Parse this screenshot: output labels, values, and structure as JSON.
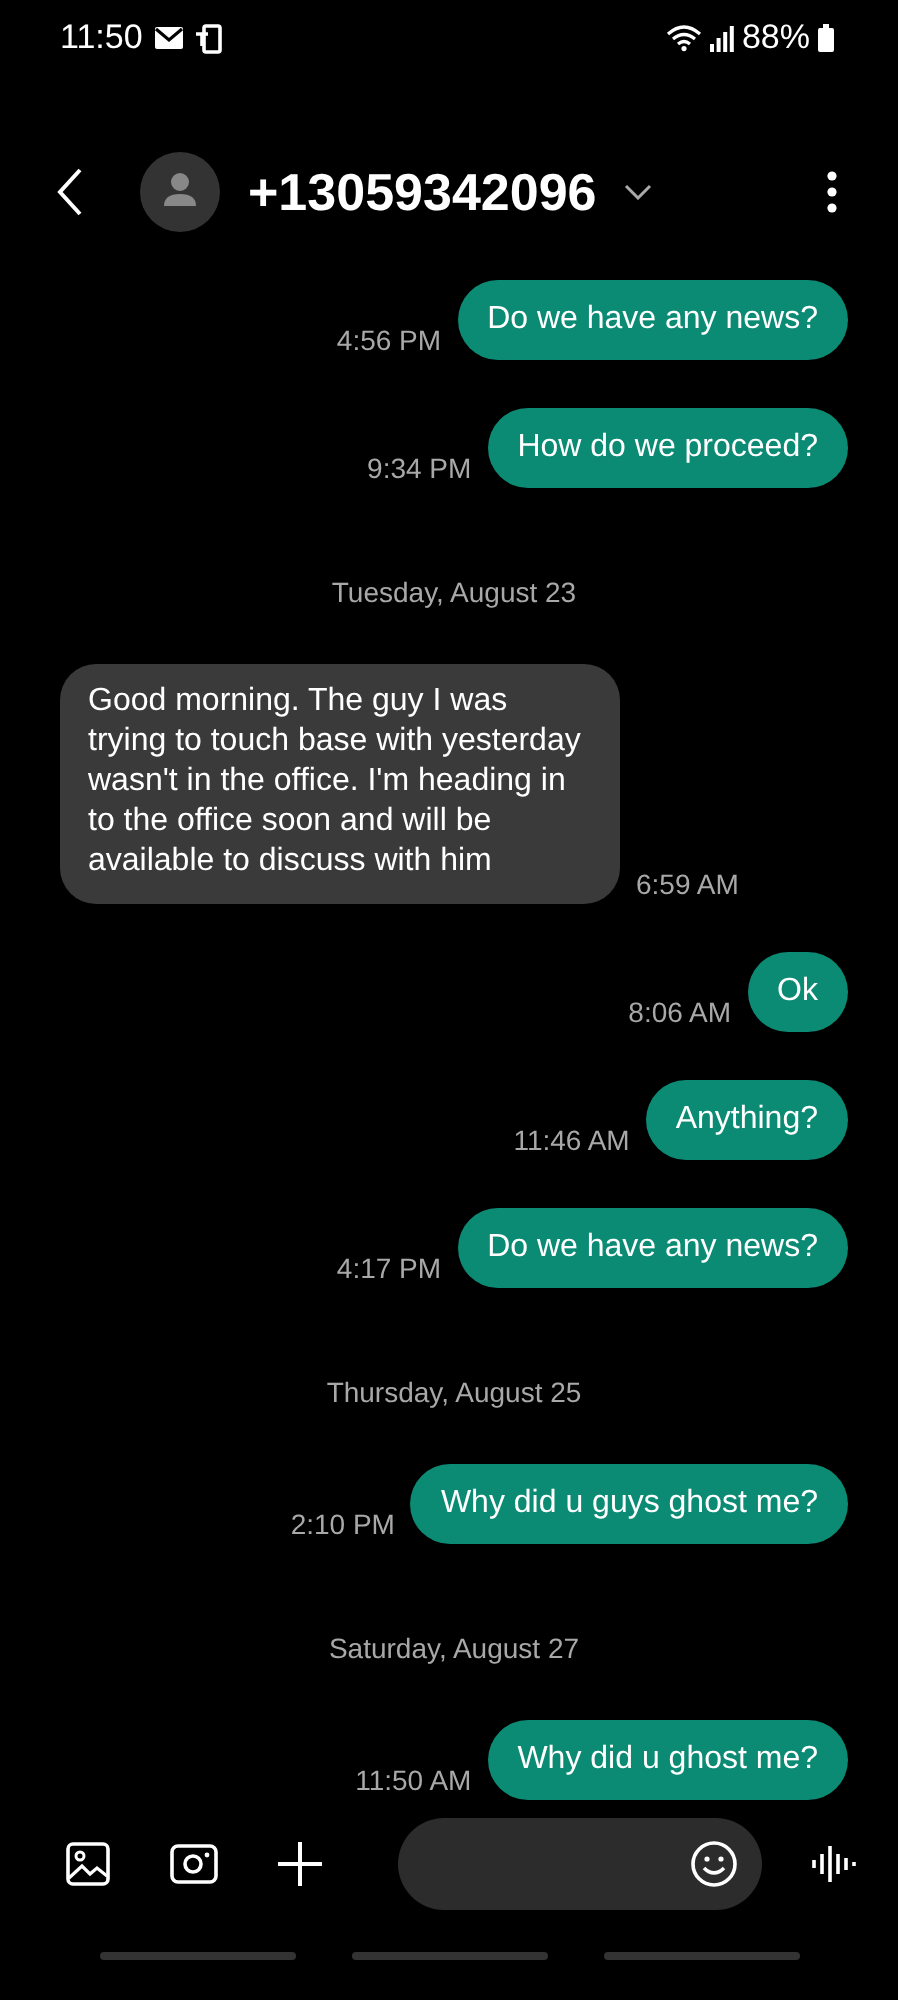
{
  "status_bar": {
    "time": "11:50",
    "battery": "88%"
  },
  "header": {
    "title": "+13059342096"
  },
  "messages": [
    {
      "kind": "sent",
      "text": "Do we have any news?",
      "time": "4:56 PM"
    },
    {
      "kind": "sent",
      "text": "How do we proceed?",
      "time": "9:34 PM"
    },
    {
      "kind": "date",
      "text": "Tuesday, August 23"
    },
    {
      "kind": "received",
      "text": "Good morning. The guy I was trying to touch base with yesterday wasn't in the office. I'm heading in to the office soon and will be available to discuss with him",
      "time": "6:59 AM"
    },
    {
      "kind": "sent",
      "text": "Ok",
      "time": "8:06 AM"
    },
    {
      "kind": "sent",
      "text": "Anything?",
      "time": "11:46 AM"
    },
    {
      "kind": "sent",
      "text": "Do we have any news?",
      "time": "4:17 PM"
    },
    {
      "kind": "date",
      "text": "Thursday, August 25"
    },
    {
      "kind": "sent",
      "text": "Why did u guys ghost me?",
      "time": "2:10 PM"
    },
    {
      "kind": "date",
      "text": "Saturday, August 27"
    },
    {
      "kind": "sent",
      "text": "Why did u ghost me?",
      "time": "11:50 AM"
    }
  ]
}
